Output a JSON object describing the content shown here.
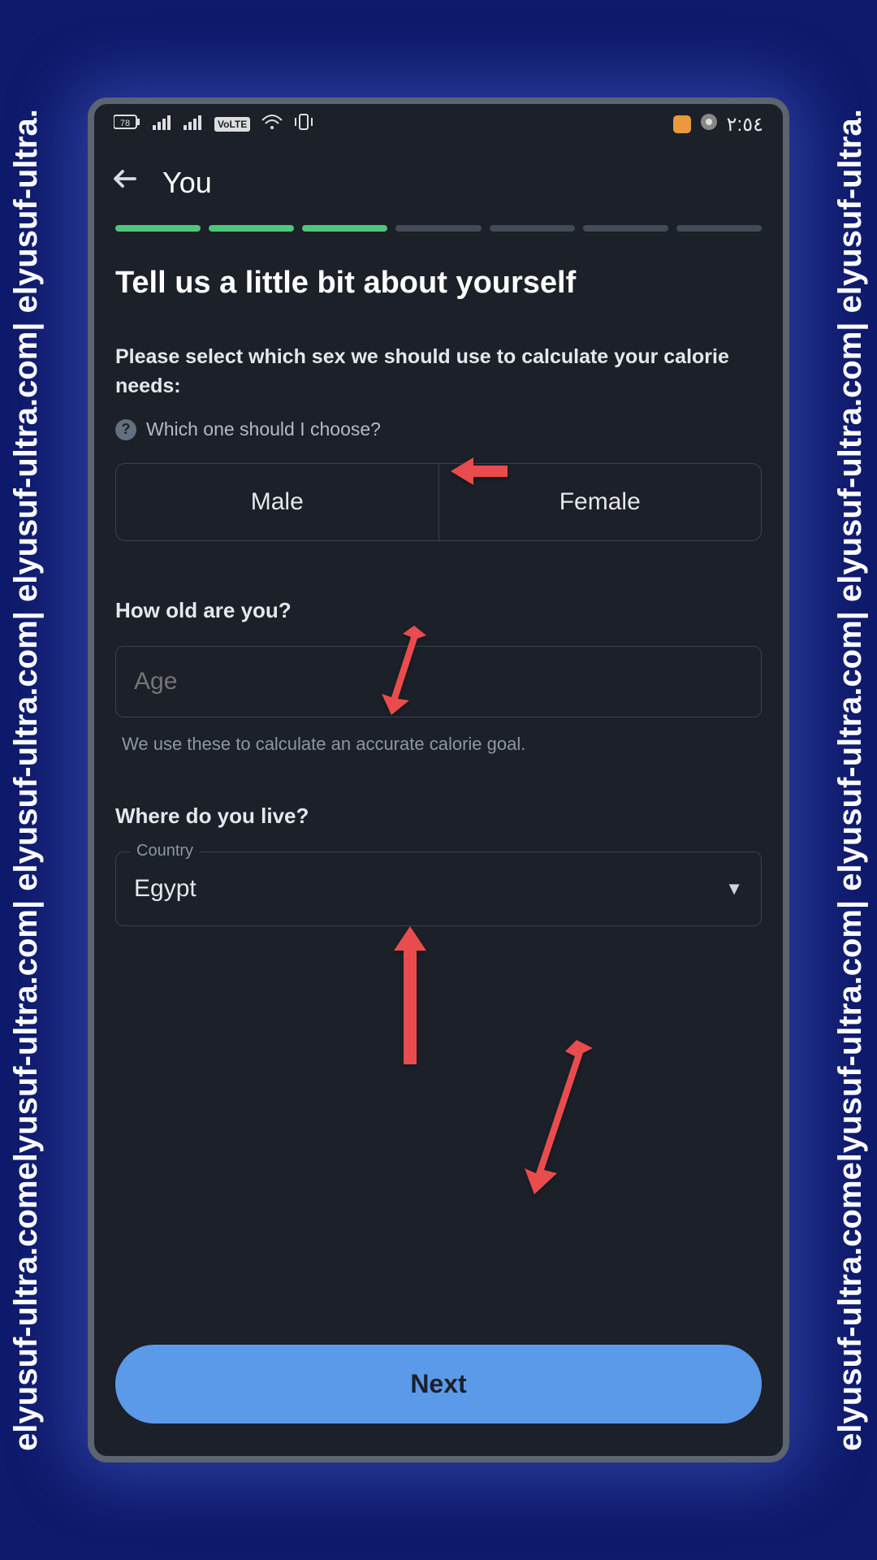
{
  "watermark": "elyusuf-ultra.comelyusuf-ultra.com| elyusuf-ultra.com| elyusuf-ultra.com| elyusuf-ultra.",
  "status": {
    "battery": "78",
    "volte": "VoLTE",
    "time": "٢:٥٤"
  },
  "nav": {
    "title": "You"
  },
  "progress": {
    "done": 3,
    "total": 7
  },
  "heading": "Tell us a little bit about yourself",
  "sex": {
    "prompt": "Please select which sex we should use to calculate your calorie needs:",
    "help": "Which one should I choose?",
    "options": {
      "male": "Male",
      "female": "Female"
    }
  },
  "age": {
    "label": "How old are you?",
    "placeholder": "Age",
    "hint": "We use these to calculate an accurate calorie goal."
  },
  "country": {
    "label": "Where do you live?",
    "float": "Country",
    "value": "Egypt"
  },
  "next": "Next"
}
